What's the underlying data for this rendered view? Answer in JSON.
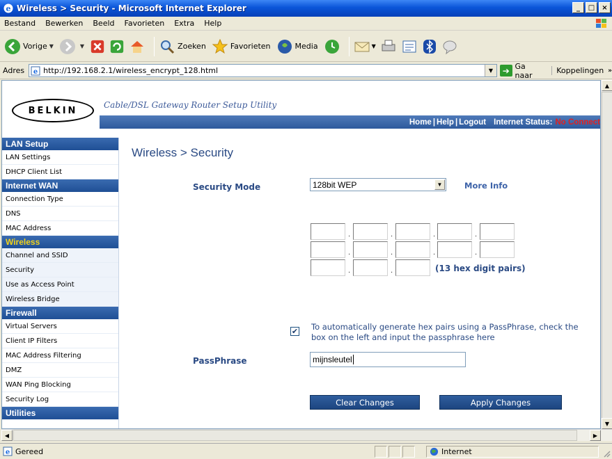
{
  "window": {
    "title": "Wireless > Security - Microsoft Internet Explorer",
    "min": "_",
    "max": "□",
    "close": "×"
  },
  "menu": [
    "Bestand",
    "Bewerken",
    "Beeld",
    "Favorieten",
    "Extra",
    "Help"
  ],
  "toolbar": {
    "back": "Vorige",
    "search": "Zoeken",
    "favorites": "Favorieten",
    "media": "Media"
  },
  "address": {
    "label": "Adres",
    "url": "http://192.168.2.1/wireless_encrypt_128.html",
    "go": "Ga naar",
    "links": "Koppelingen"
  },
  "header": {
    "logo": "BELKIN",
    "tagline": "Cable/DSL Gateway Router Setup Utility",
    "nav": {
      "home": "Home",
      "help": "Help",
      "logout": "Logout",
      "sep": "|",
      "internet_status": "Internet Status:",
      "status_value": "No Connect"
    }
  },
  "sidebar": {
    "sections": [
      {
        "title": "LAN Setup",
        "items": [
          "LAN Settings",
          "DHCP Client List"
        ]
      },
      {
        "title": "Internet WAN",
        "items": [
          "Connection Type",
          "DNS",
          "MAC Address"
        ]
      },
      {
        "title": "Wireless",
        "items": [
          "Channel and SSID",
          "Security",
          "Use as Access Point",
          "Wireless Bridge"
        ]
      },
      {
        "title": "Firewall",
        "items": [
          "Virtual Servers",
          "Client IP Filters",
          "MAC Address Filtering",
          "DMZ",
          "WAN Ping Blocking",
          "Security Log"
        ]
      },
      {
        "title": "Utilities",
        "items": []
      }
    ]
  },
  "main": {
    "title": "Wireless > Security",
    "security_mode_label": "Security Mode",
    "security_mode_value": "128bit WEP",
    "more_info": "More Info",
    "hex_note": "(13 hex digit pairs)",
    "hex_dot": ".",
    "auto_text": "To automatically generate hex pairs using a PassPhrase, check the box on the left and input the passphrase here",
    "auto_checked_mark": "✔",
    "passphrase_label": "PassPhrase",
    "passphrase_value": "mijnsleutel",
    "clear_button": "Clear Changes",
    "apply_button": "Apply Changes"
  },
  "status": {
    "text": "Gereed",
    "zone": "Internet"
  }
}
